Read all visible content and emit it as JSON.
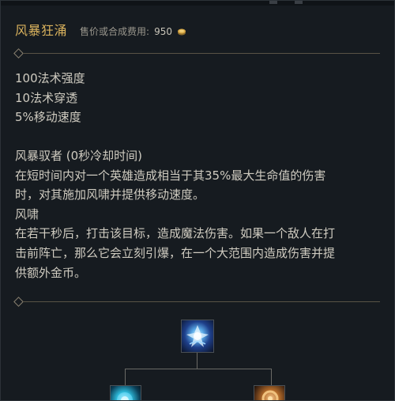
{
  "item": {
    "name": "风暴狂涌",
    "cost_label": "售价或合成费用:",
    "cost_value": "950"
  },
  "stats": [
    "100法术强度",
    "10法术穿透",
    "5%移动速度"
  ],
  "passives": [
    "风暴驭者 (0秒冷却时间)",
    "在短时间内对一个英雄造成相当于其35%最大生命值的伤害",
    "时，对其施加风啸并提供移动速度。",
    "风啸",
    "在若干秒后，打击该目标，造成魔法伤害。如果一个敌人在打",
    "击前阵亡，那么它会立刻引爆，在一个大范围内造成伤害并提",
    "供额外金币。"
  ],
  "icons": {
    "coin": "gold-coin-icon",
    "main": "stormsurge-item-icon",
    "component_left": "lost-chapter-like-icon",
    "component_right": "blasting-wand-like-icon"
  },
  "colors": {
    "title": "#d8b15d",
    "text": "#cfcbc0",
    "background": "#161b20"
  }
}
